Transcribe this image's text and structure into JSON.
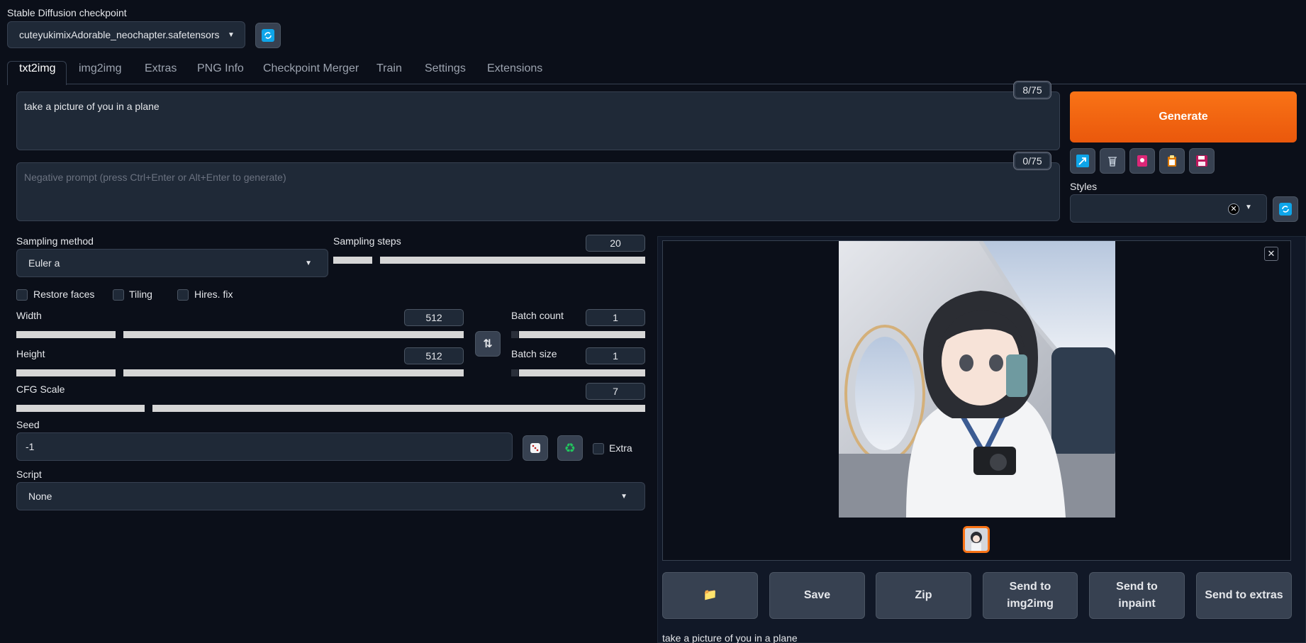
{
  "checkpoint": {
    "label": "Stable Diffusion checkpoint",
    "value": "cuteyukimixAdorable_neochapter.safetensors [c"
  },
  "tabs": [
    "txt2img",
    "img2img",
    "Extras",
    "PNG Info",
    "Checkpoint Merger",
    "Train",
    "Settings",
    "Extensions"
  ],
  "prompt": {
    "text": "take a picture of you in a plane",
    "counter": "8/75"
  },
  "negative_prompt": {
    "placeholder": "Negative prompt (press Ctrl+Enter or Alt+Enter to generate)",
    "counter": "0/75"
  },
  "generate_label": "Generate",
  "styles_label": "Styles",
  "sampling": {
    "method_label": "Sampling method",
    "method_value": "Euler a",
    "steps_label": "Sampling steps",
    "steps_value": "20"
  },
  "checkboxes": {
    "restore_faces": "Restore faces",
    "tiling": "Tiling",
    "hires_fix": "Hires. fix",
    "extra": "Extra"
  },
  "width": {
    "label": "Width",
    "value": "512"
  },
  "height": {
    "label": "Height",
    "value": "512"
  },
  "batch_count": {
    "label": "Batch count",
    "value": "1"
  },
  "batch_size": {
    "label": "Batch size",
    "value": "1"
  },
  "cfg": {
    "label": "CFG Scale",
    "value": "7"
  },
  "seed": {
    "label": "Seed",
    "value": "-1"
  },
  "script": {
    "label": "Script",
    "value": "None"
  },
  "output_buttons": {
    "save": "Save",
    "zip": "Zip",
    "send_img2img": "Send to img2img",
    "send_inpaint": "Send to inpaint",
    "send_extras": "Send to extras"
  },
  "output_caption": "take a picture of you in a plane",
  "colors": {
    "background": "#0b0f19",
    "panel": "#1f2937",
    "generate": "#f97316",
    "accent_blue": "#0ea5e9"
  }
}
